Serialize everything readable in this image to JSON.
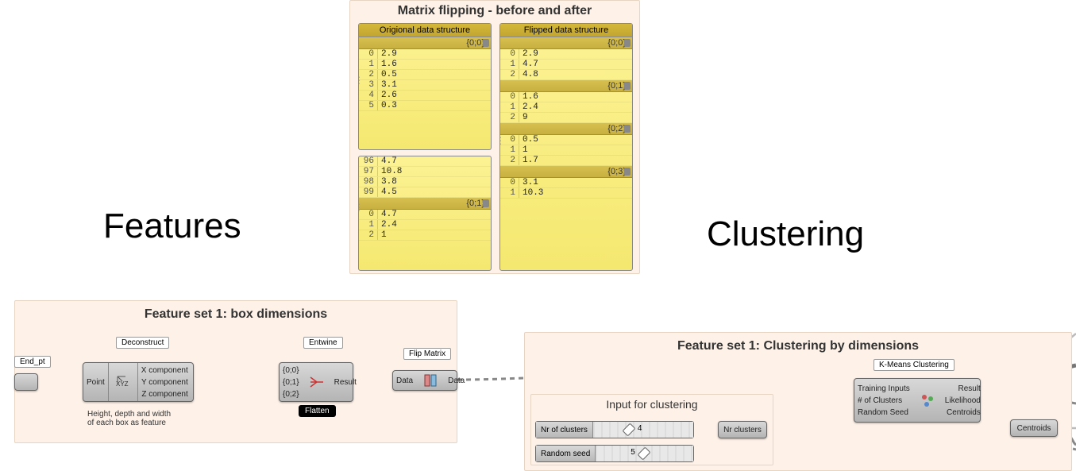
{
  "big_labels": {
    "features": "Features",
    "clustering": "Clustering"
  },
  "matrix_group": {
    "title": "Matrix flipping - before and after",
    "original": {
      "header": "Origional data structure",
      "path0": "{0;0}",
      "rows0": [
        {
          "i": "0",
          "v": "2.9"
        },
        {
          "i": "1",
          "v": "1.6"
        },
        {
          "i": "2",
          "v": "0.5"
        },
        {
          "i": "3",
          "v": "3.1"
        },
        {
          "i": "4",
          "v": "2.6"
        },
        {
          "i": "5",
          "v": "0.3"
        }
      ],
      "rows1": [
        {
          "i": "96",
          "v": "4.7"
        },
        {
          "i": "97",
          "v": "10.8"
        },
        {
          "i": "98",
          "v": "3.8"
        },
        {
          "i": "99",
          "v": "4.5"
        }
      ],
      "path1": "{0;1}",
      "rows2": [
        {
          "i": "0",
          "v": "4.7"
        },
        {
          "i": "1",
          "v": "2.4"
        },
        {
          "i": "2",
          "v": "1"
        }
      ]
    },
    "flipped": {
      "header": "Flipped data structure",
      "path0": "{0;0}",
      "rows0": [
        {
          "i": "0",
          "v": "2.9"
        },
        {
          "i": "1",
          "v": "4.7"
        },
        {
          "i": "2",
          "v": "4.8"
        }
      ],
      "path1": "{0;1}",
      "rows1": [
        {
          "i": "0",
          "v": "1.6"
        },
        {
          "i": "1",
          "v": "2.4"
        },
        {
          "i": "2",
          "v": "9"
        }
      ],
      "path2": "{0;2}",
      "rows2": [
        {
          "i": "0",
          "v": "0.5"
        },
        {
          "i": "1",
          "v": "1"
        },
        {
          "i": "2",
          "v": "1.7"
        }
      ],
      "path3": "{0;3}",
      "rows3": [
        {
          "i": "0",
          "v": "3.1"
        },
        {
          "i": "1",
          "v": "10.3"
        }
      ]
    }
  },
  "feature_group": {
    "title": "Feature set 1: box dimensions",
    "deconstruct_label": "Deconstruct",
    "entwine_label": "Entwine",
    "flip_label": "Flip Matrix",
    "end_pt": "End_pt",
    "point": "Point",
    "xc": "X component",
    "yc": "Y component",
    "zc": "Z component",
    "e00": "{0;0}",
    "e01": "{0;1}",
    "e02": "{0;2}",
    "result": "Result",
    "data_l": "Data",
    "data_r": "Data",
    "flatten": "Flatten",
    "note": "Height, depth and width\nof each box as feature"
  },
  "cluster_group": {
    "title": "Feature set 1: Clustering by dimensions",
    "kmeans_label": "K-Means Clustering",
    "training": "Training Inputs",
    "nclusters": "# of Clusters",
    "seed": "Random Seed",
    "out_result": "Result",
    "out_like": "Likelihood",
    "out_cent": "Centroids",
    "centroids_comp": "Centroids",
    "input_title": "Input for clustering",
    "slider1_label": "Nr of clusters",
    "slider1_val": "4",
    "nr_clusters": "Nr clusters",
    "slider2_label": "Random seed",
    "slider2_val": "5"
  }
}
